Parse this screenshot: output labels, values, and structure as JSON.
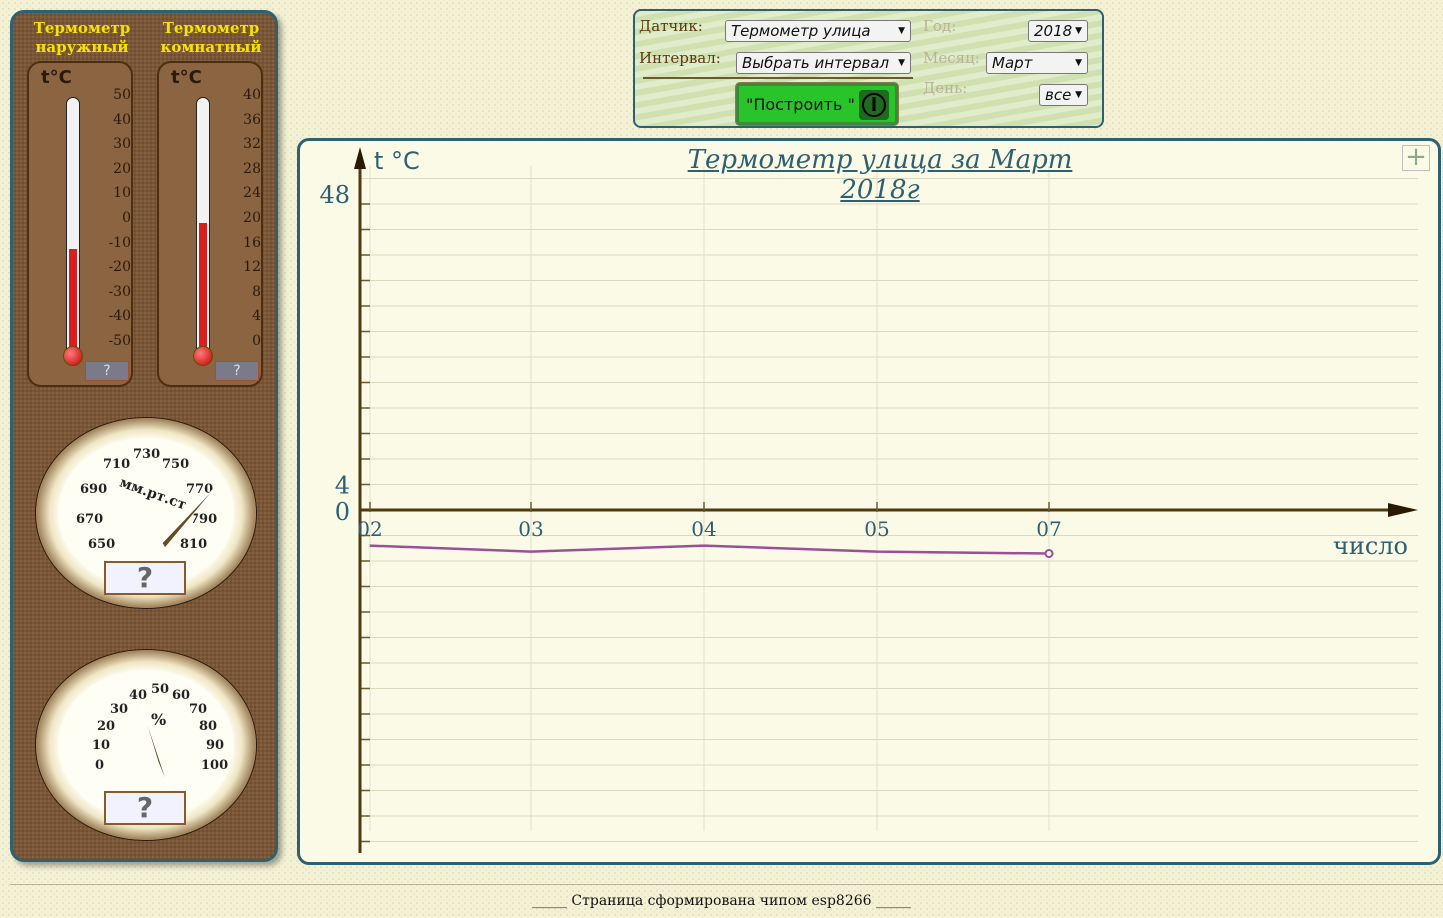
{
  "sidebar": {
    "outdoor_title": "Термометр наружный",
    "indoor_title": "Термометр комнатный",
    "outdoor": {
      "unit": "t°C",
      "ticks": [
        "50",
        "40",
        "30",
        "20",
        "10",
        "0",
        "-10",
        "-20",
        "-30",
        "-40",
        "-50"
      ],
      "fill_fraction": 0.42,
      "value": "?"
    },
    "indoor": {
      "unit": "t°C",
      "ticks": [
        "40",
        "36",
        "32",
        "28",
        "24",
        "20",
        "16",
        "12",
        "8",
        "4",
        "0"
      ],
      "fill_fraction": 0.52,
      "value": "?"
    },
    "barometer": {
      "unit": "мм.рт.ст",
      "ticks": [
        "650",
        "670",
        "690",
        "710",
        "730",
        "750",
        "770",
        "790",
        "810"
      ],
      "value": "?"
    },
    "hygrometer": {
      "unit": "%",
      "ticks": [
        "0",
        "10",
        "20",
        "30",
        "40",
        "50",
        "60",
        "70",
        "80",
        "90",
        "100"
      ],
      "value": "?"
    }
  },
  "controls": {
    "sensor_label": "Датчик:",
    "sensor_value": "Термометр улица",
    "interval_label": "Интервал:",
    "interval_value": "Выбрать интервал",
    "year_label": "Год:",
    "year_value": "2018",
    "month_label": "Месяц:",
    "month_value": "Март",
    "day_label": "День:",
    "day_value": "все",
    "build_label": "\"Построить \""
  },
  "chart": {
    "expand_symbol": "+"
  },
  "chart_data": {
    "type": "line",
    "title": "Термометр улица за Март 2018г",
    "ylabel": "t °C",
    "xlabel": "число",
    "y_tick_labels": [
      "48",
      "4",
      "0"
    ],
    "categories": [
      "02",
      "03",
      "04",
      "05",
      "07"
    ],
    "series": [
      {
        "values": [
          -5.4,
          -6.3,
          -5.4,
          -6.3,
          -6.6
        ],
        "color": "#9b4f9b"
      }
    ],
    "ylim": [
      -13,
      49
    ],
    "grid": true
  },
  "footer": {
    "text": "_____ Страница сформирована чипом esp8266 _____"
  }
}
